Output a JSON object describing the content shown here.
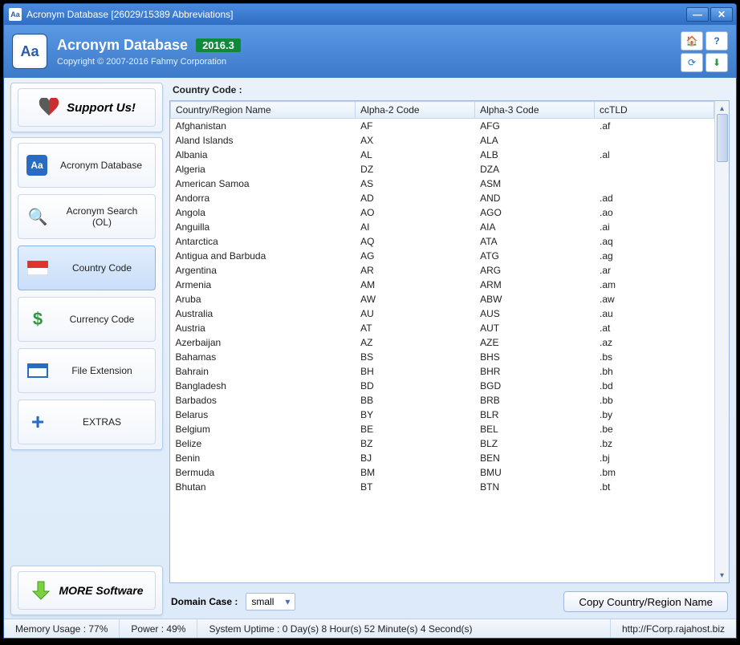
{
  "window": {
    "title": "Acronym Database [26029/15389 Abbreviations]"
  },
  "header": {
    "app_title": "Acronym Database",
    "version": "2016.3",
    "copyright": "Copyright © 2007-2016 Fahmy Corporation"
  },
  "sidebar": {
    "support": "Support Us!",
    "items": [
      {
        "label": "Acronym Database"
      },
      {
        "label": "Acronym Search (OL)"
      },
      {
        "label": "Country Code"
      },
      {
        "label": "Currency Code"
      },
      {
        "label": "File Extension"
      },
      {
        "label": "EXTRAS"
      }
    ],
    "more": "MORE Software"
  },
  "main": {
    "section_title": "Country Code :",
    "columns": [
      "Country/Region Name",
      "Alpha-2 Code",
      "Alpha-3 Code",
      "ccTLD"
    ],
    "rows": [
      [
        "Afghanistan",
        "AF",
        "AFG",
        ".af"
      ],
      [
        "Aland Islands",
        "AX",
        "ALA",
        ""
      ],
      [
        "Albania",
        "AL",
        "ALB",
        ".al"
      ],
      [
        "Algeria",
        "DZ",
        "DZA",
        ""
      ],
      [
        "American Samoa",
        "AS",
        "ASM",
        ""
      ],
      [
        "Andorra",
        "AD",
        "AND",
        ".ad"
      ],
      [
        "Angola",
        "AO",
        "AGO",
        ".ao"
      ],
      [
        "Anguilla",
        "AI",
        "AIA",
        ".ai"
      ],
      [
        "Antarctica",
        "AQ",
        "ATA",
        ".aq"
      ],
      [
        "Antigua and Barbuda",
        "AG",
        "ATG",
        ".ag"
      ],
      [
        "Argentina",
        "AR",
        "ARG",
        ".ar"
      ],
      [
        "Armenia",
        "AM",
        "ARM",
        ".am"
      ],
      [
        "Aruba",
        "AW",
        "ABW",
        ".aw"
      ],
      [
        "Australia",
        "AU",
        "AUS",
        ".au"
      ],
      [
        "Austria",
        "AT",
        "AUT",
        ".at"
      ],
      [
        "Azerbaijan",
        "AZ",
        "AZE",
        ".az"
      ],
      [
        "Bahamas",
        "BS",
        "BHS",
        ".bs"
      ],
      [
        "Bahrain",
        "BH",
        "BHR",
        ".bh"
      ],
      [
        "Bangladesh",
        "BD",
        "BGD",
        ".bd"
      ],
      [
        "Barbados",
        "BB",
        "BRB",
        ".bb"
      ],
      [
        "Belarus",
        "BY",
        "BLR",
        ".by"
      ],
      [
        "Belgium",
        "BE",
        "BEL",
        ".be"
      ],
      [
        "Belize",
        "BZ",
        "BLZ",
        ".bz"
      ],
      [
        "Benin",
        "BJ",
        "BEN",
        ".bj"
      ],
      [
        "Bermuda",
        "BM",
        "BMU",
        ".bm"
      ],
      [
        "Bhutan",
        "BT",
        "BTN",
        ".bt"
      ]
    ],
    "domain_case_label": "Domain Case :",
    "domain_case_value": "small",
    "copy_button": "Copy Country/Region Name"
  },
  "status": {
    "memory": "Memory Usage : 77%",
    "power": "Power : 49%",
    "uptime": "System Uptime : 0 Day(s) 8 Hour(s) 52 Minute(s) 4 Second(s)",
    "url": "http://FCorp.rajahost.biz"
  }
}
